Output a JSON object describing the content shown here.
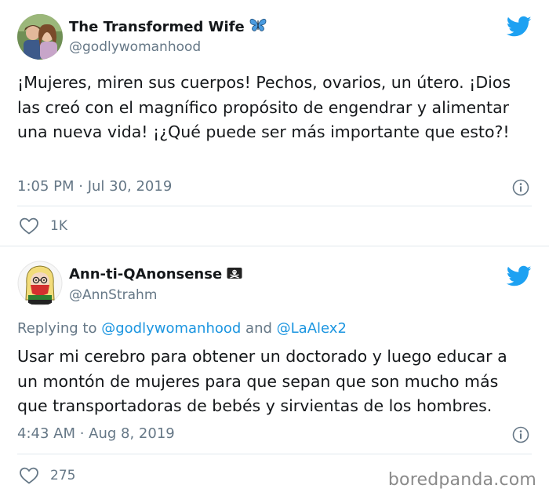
{
  "tweets": [
    {
      "author": {
        "name": "The Transformed Wife",
        "name_emoji": "🦋",
        "handle": "@godlywomanhood"
      },
      "text": "¡Mujeres, miren sus cuerpos! Pechos, ovarios, un útero. ¡Dios las creó con el magnífico propósito de engendrar y alimentar una nueva vida! ¡¿Qué puede ser más importante que esto?!",
      "timestamp": "1:05 PM · Jul 30, 2019",
      "likes": "1K"
    },
    {
      "author": {
        "name": "Ann-ti-QAnonsense",
        "name_emoji": "🏴‍☠️",
        "handle": "@AnnStrahm"
      },
      "replying": {
        "prefix": "Replying to",
        "mention1": "@godlywomanhood",
        "joiner": "and",
        "mention2": "@LaAlex2"
      },
      "text": "Usar mi cerebro para obtener un doctorado y luego educar a un montón de mujeres para que sepan que son mucho más que transportadoras de bebés y sirvientas de los hombres.",
      "timestamp": "4:43 AM · Aug 8, 2019",
      "likes": "275"
    }
  ],
  "watermark": "boredpanda.com",
  "colors": {
    "twitter_blue": "#1da1f2",
    "mention_blue": "#1b95e0",
    "secondary_text": "#657786",
    "divider": "#e1e8ed"
  },
  "icons": {
    "brand": "twitter-bird-icon",
    "info": "info-icon",
    "like": "heart-icon"
  }
}
